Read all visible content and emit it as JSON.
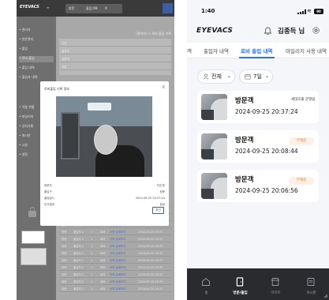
{
  "desktop": {
    "logo": "EYEVACS",
    "topbar_tabs": [
      "방문",
      "출입기록",
      "X"
    ],
    "page_heading": "[관리자] > 로비 출입 기록",
    "sidebar_items": [
      "• 관리자",
      "• 방문관리",
      "• 출입",
      "• 로비 출입",
      "• 출입 내역",
      "• 출입자 내역",
      "• 이용 현황",
      "• 마일리지",
      "• 공지사항",
      "• 게시판",
      "• 시설",
      "• 설정"
    ],
    "filter_labels": [
      "기간",
      "출입자",
      "방문객",
      "구분"
    ],
    "modal_title": "로비출입 기록 정보",
    "modal_fields": [
      {
        "key": "방문자",
        "value": "기업 문"
      },
      {
        "key": "출입구",
        "value": "정문"
      },
      {
        "key": "출입일시",
        "value": "2024-09-25 20:37:24"
      },
      {
        "key": "인식결과",
        "value": "정상"
      }
    ],
    "modal_close_label": "X",
    "modal_confirm_label": "확인",
    "grid_rows": [
      [
        "방문",
        "출입자 2",
        "1",
        "로비",
        "이력 상세보기",
        "2024-09-25 20:37"
      ],
      [
        "방문",
        "출입자 2",
        "1",
        "로비",
        "이력 상세보기",
        "2024-09-25 20:37"
      ],
      [
        "방문",
        "출입자 2",
        "1",
        "로비",
        "이력 상세보기",
        "2024-09-25 20:37"
      ],
      [
        "방문",
        "출입자 2",
        "1",
        "로비",
        "이력 상세보기",
        "2024-09-25 20:37"
      ],
      [
        "방문",
        "출입자 2",
        "1",
        "로비",
        "이력 상세보기",
        "2024-09-25 20:37"
      ],
      [
        "방문",
        "출입자 2",
        "1",
        "로비",
        "이력 상세보기",
        "2024-09-25 20:37"
      ],
      [
        "방문",
        "출입자 2",
        "1",
        "로비",
        "이력 상세보기",
        "2024-09-25 20:37"
      ],
      [
        "방문",
        "출입자 2",
        "1",
        "로비",
        "이력 상세보기",
        "2024-09-25 20:37"
      ],
      [
        "방문",
        "출입자 2",
        "1",
        "로비",
        "이력 상세보기",
        "2024-09-25 20:37"
      ],
      [
        "방문",
        "출입자 2",
        "1",
        "로비",
        "이력 상세보기",
        "2024-09-25 20:37"
      ],
      [
        "방문",
        "출입자 2",
        "1",
        "로비",
        "이력 상세보기",
        "2024-09-25 20:37"
      ],
      [
        "방문",
        "출입자 2",
        "1",
        "로비",
        "이력 상세보기",
        "2024-09-25 20:37"
      ],
      [
        "방문",
        "출입자 2",
        "1",
        "로비",
        "이력 상세보기",
        "2024-09-25 20:37"
      ]
    ]
  },
  "mobile": {
    "status_time": "1:40",
    "battery": "90",
    "app_logo": "EYEVACS",
    "user_name": "김종득 님",
    "tabs": [
      "객",
      "출입자 내역",
      "로비 출입 내역",
      "마일리지 사용 내역"
    ],
    "active_tab_index": 2,
    "filter_scope": "전체",
    "filter_period": "7일",
    "cards": [
      {
        "title": "방문객",
        "time": "2024-09-25 20:37:24",
        "tag": "세대호출 문열림",
        "badge": ""
      },
      {
        "title": "방문객",
        "time": "2024-09-25 20:08:44",
        "tag": "",
        "badge": "부재중"
      },
      {
        "title": "방문객",
        "time": "2024-09-25 20:06:56",
        "tag": "",
        "badge": "부재중"
      }
    ],
    "nav": [
      {
        "label": "홈",
        "icon": "home-icon",
        "active": false
      },
      {
        "label": "방문/출입",
        "icon": "door-icon",
        "active": true
      },
      {
        "label": "이마트",
        "icon": "store-icon",
        "active": false
      },
      {
        "label": "게시판",
        "icon": "board-icon",
        "active": false
      }
    ],
    "colors": {
      "accent": "#2d6ef2",
      "badge_text": "#f07a2b",
      "badge_bg": "#fff0e6",
      "nav_bg": "#2a2b2f"
    }
  }
}
